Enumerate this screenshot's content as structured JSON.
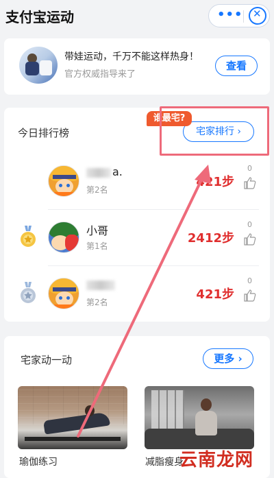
{
  "header": {
    "title": "支付宝运动"
  },
  "promo": {
    "title": "带娃运动，千万不能这样热身！",
    "subtitle": "官方权威指导来了",
    "button": "查看"
  },
  "ranking": {
    "title": "今日排行榜",
    "badge": "谁最宅?",
    "button": "宅家排行",
    "rows": [
      {
        "name": "a.",
        "rank_label": "第2名",
        "steps": "421步",
        "likes": "0"
      },
      {
        "name": "小哥",
        "rank_label": "第1名",
        "steps": "2412步",
        "likes": "0"
      },
      {
        "name": "",
        "rank_label": "第2名",
        "steps": "421步",
        "likes": "0"
      }
    ]
  },
  "move": {
    "title": "宅家动一动",
    "more": "更多",
    "tiles": [
      {
        "label": "瑜伽练习"
      },
      {
        "label": "减脂瘦身"
      }
    ]
  },
  "watermark": "云南龙网",
  "colors": {
    "accent": "#1677ff",
    "steps_red": "#e02f2f",
    "annotation_pink": "#ee6a7a",
    "badge_orange": "#ef5a2e",
    "watermark_red": "#d12d20"
  },
  "icons": {
    "more": "more-dots-icon",
    "close": "close-icon",
    "like": "thumbs-up-icon",
    "gold_medal": "gold-medal-icon",
    "silver_medal": "silver-medal-icon",
    "chevron": "chevron-right-icon"
  }
}
